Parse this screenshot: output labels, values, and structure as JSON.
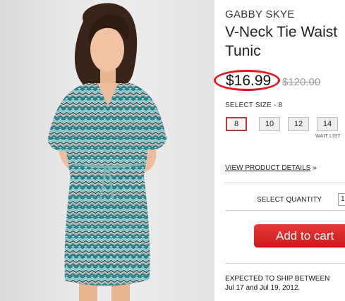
{
  "product": {
    "brand": "GABBY SKYE",
    "name": "V-Neck Tie Waist Tunic",
    "price": "$16.99",
    "original_price": "$120.00"
  },
  "size_selector": {
    "label": "SELECT SIZE - 8",
    "options": [
      "8",
      "10",
      "12",
      "14"
    ],
    "selected": "8",
    "wait_list_label": "WAIT LIST"
  },
  "details_link": "VIEW PRODUCT DETAILS",
  "details_arrow": "»",
  "quantity": {
    "label": "SELECT QUANTITY",
    "value": "1"
  },
  "cart_button": "Add to cart",
  "shipping": {
    "line1": "EXPECTED TO SHIP BETWEEN",
    "line2": "Jul 17 and Jul 19, 2012."
  },
  "colors": {
    "accent_red": "#d61d20",
    "highlight_circle": "#e3171e",
    "dress_teal": "#2e8f98"
  }
}
